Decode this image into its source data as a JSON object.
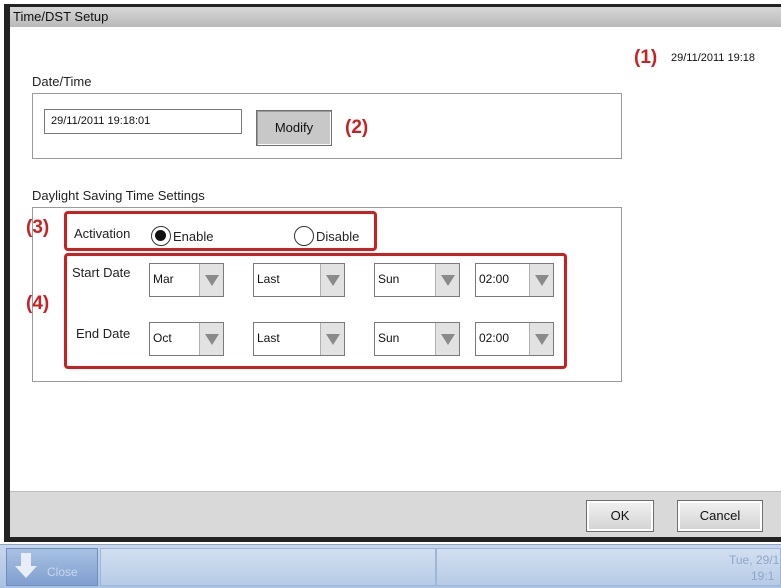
{
  "window": {
    "title": "Time/DST Setup"
  },
  "current_datetime": "29/11/2011 19:18",
  "date_time": {
    "group_label": "Date/Time",
    "value": "29/11/2011 19:18:01",
    "modify_label": "Modify"
  },
  "dst": {
    "group_label": "Daylight Saving Time Settings",
    "activation_label": "Activation",
    "enable_label": "Enable",
    "disable_label": "Disable",
    "activation_selected": "Enable",
    "start_label": "Start Date",
    "end_label": "End Date",
    "start": {
      "month": "Mar",
      "week": "Last",
      "day": "Sun",
      "time": "02:00"
    },
    "end": {
      "month": "Oct",
      "week": "Last",
      "day": "Sun",
      "time": "02:00"
    }
  },
  "annotations": {
    "a1": "(1)",
    "a2": "(2)",
    "a3": "(3)",
    "a4": "(4)",
    "color": "#cc1f1f"
  },
  "footer": {
    "ok_label": "OK",
    "cancel_label": "Cancel"
  },
  "taskbar": {
    "close_label": "Close",
    "date": "Tue, 29/1",
    "time": "19:1"
  }
}
